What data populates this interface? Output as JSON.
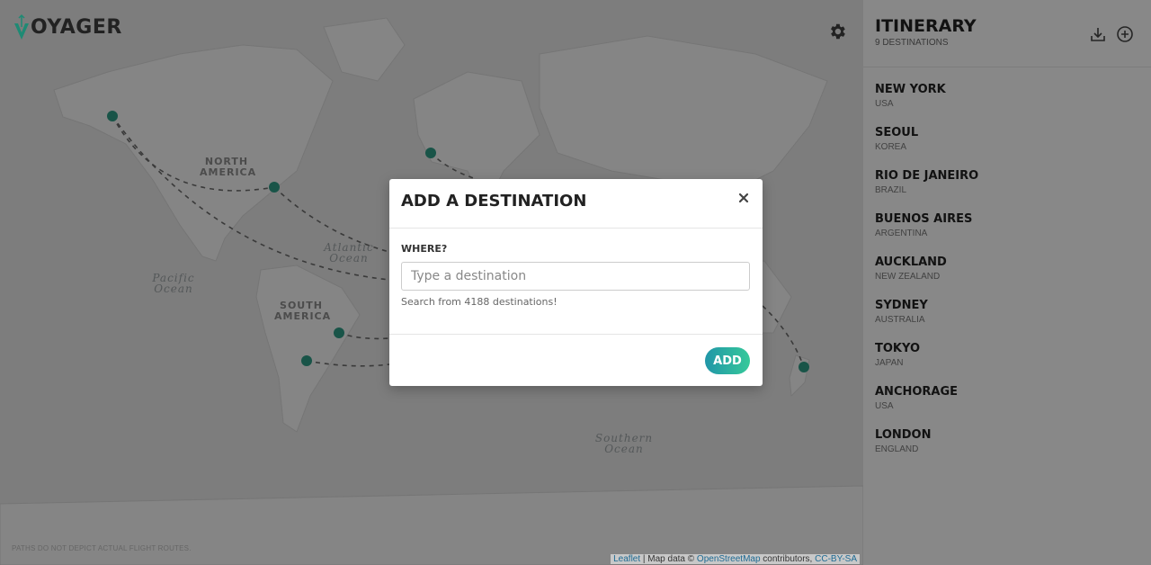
{
  "app": {
    "logo_text": "OYAGER"
  },
  "map": {
    "continent_labels": [
      "NORTH",
      "AMERICA",
      "SOUTH",
      "AMERICA"
    ],
    "ocean_labels": [
      "Pacific",
      "Ocean",
      "Atlantic",
      "Ocean",
      "Southern",
      "Ocean"
    ],
    "disclaimer": "PATHS DO NOT DEPICT ACTUAL FLIGHT ROUTES.",
    "attribution": {
      "leaflet": "Leaflet",
      "sep": " | Map data © ",
      "osm": "OpenStreetMap",
      "contrib": " contributors, ",
      "license": "CC-BY-SA"
    },
    "marker_color": "#2f9a84"
  },
  "sidebar": {
    "title": "ITINERARY",
    "count": "9 DESTINATIONS",
    "destinations": [
      {
        "name": "NEW YORK",
        "country": "USA"
      },
      {
        "name": "SEOUL",
        "country": "KOREA"
      },
      {
        "name": "RIO DE JANEIRO",
        "country": "BRAZIL"
      },
      {
        "name": "BUENOS AIRES",
        "country": "ARGENTINA"
      },
      {
        "name": "AUCKLAND",
        "country": "NEW ZEALAND"
      },
      {
        "name": "SYDNEY",
        "country": "AUSTRALIA"
      },
      {
        "name": "TOKYO",
        "country": "JAPAN"
      },
      {
        "name": "ANCHORAGE",
        "country": "USA"
      },
      {
        "name": "LONDON",
        "country": "ENGLAND"
      }
    ]
  },
  "modal": {
    "title": "ADD A DESTINATION",
    "label": "WHERE?",
    "input_value": "",
    "placeholder": "Type a destination",
    "help": "Search from 4188 destinations!",
    "add_label": "ADD"
  }
}
